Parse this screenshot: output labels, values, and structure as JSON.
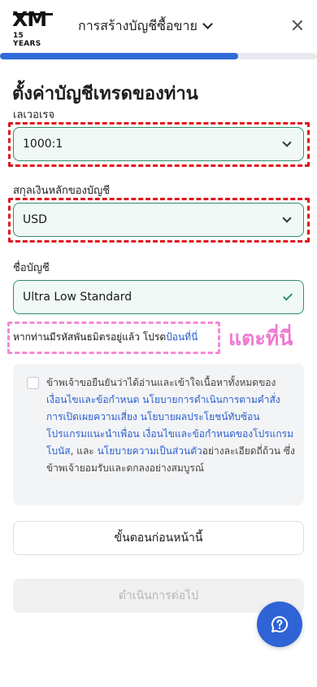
{
  "header": {
    "logo_text": "XM",
    "logo_sub": "15 YEARS",
    "title": "การสร้างบัญชีซื้อขาย",
    "close_icon": "close-icon"
  },
  "progress": {
    "fraction": 0.75,
    "color": "#2f6ad8"
  },
  "page": {
    "title": "ตั้งค่าบัญชีเทรดของท่าน"
  },
  "form": {
    "leverage": {
      "label": "เลเวอเรจ",
      "value": "1000:1"
    },
    "currency": {
      "label": "สกุลเงินหลักของบัญชี",
      "value": "USD"
    },
    "account_name": {
      "label": "ชื่อบัญชี",
      "value": "Ultra Low Standard"
    }
  },
  "partner": {
    "text": "หากท่านมีรหัสพันธมิตรอยู่แล้ว โปรด",
    "link": "ป้อนที่นี่"
  },
  "annotation": {
    "tap_here": "แตะที่นี่"
  },
  "agreement": {
    "parts": [
      {
        "t": "ข้าพเจ้าขอยืนยันว่าได้อ่านและเข้าใจเนื้อหาทั้งหมดของ",
        "link": false
      },
      {
        "t": "เงื่อนไขและข้อกำหนด",
        "link": true
      },
      {
        "t": " ",
        "link": false
      },
      {
        "t": "นโยบายการดำเนินการตามคำสั่ง",
        "link": true
      },
      {
        "t": " ",
        "link": false
      },
      {
        "t": "การเปิดเผยความเสี่ยง",
        "link": true
      },
      {
        "t": " ",
        "link": false
      },
      {
        "t": "นโยบายผลประโยชน์ทับซ้อน",
        "link": true
      },
      {
        "t": " ",
        "link": false
      },
      {
        "t": "โปรแกรมแนะนำเพื่อน",
        "link": true
      },
      {
        "t": " ",
        "link": false
      },
      {
        "t": "เงื่อนไขและข้อกำหนดของโปรแกรมโบนัส",
        "link": true
      },
      {
        "t": ", และ ",
        "link": false
      },
      {
        "t": "นโยบายความเป็นส่วนตัว",
        "link": true
      },
      {
        "t": "อย่างละเอียดถี่ถ้วน ซึ่งข้าพเจ้ายอมรับและตกลงอย่างสมบูรณ์",
        "link": false
      }
    ]
  },
  "buttons": {
    "prev": "ขั้นตอนก่อนหน้านี้",
    "next": "ดำเนินการต่อไป"
  },
  "chat": {
    "icon": "chat-help-icon"
  },
  "colors": {
    "accent": "#2f6ad8",
    "field_border": "#2e8f6a",
    "annotation_red": "#e0161f",
    "annotation_pink": "#f58ad6"
  }
}
